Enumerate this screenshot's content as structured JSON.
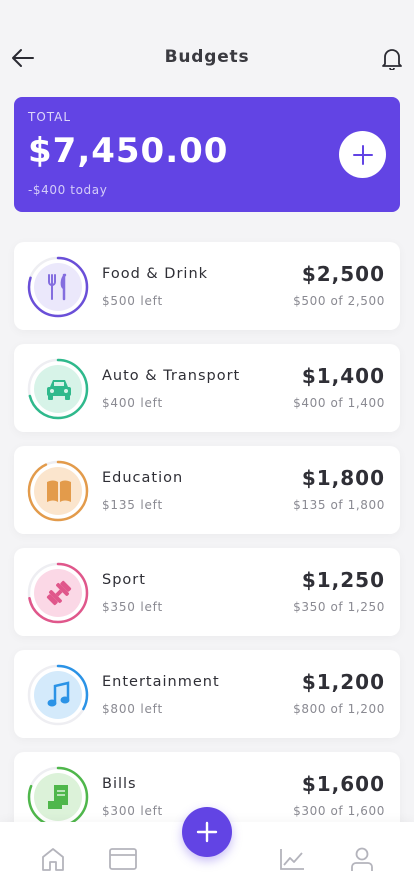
{
  "header": {
    "title": "Budgets",
    "back_icon": "arrow-left-icon",
    "notification_icon": "bell-icon"
  },
  "total": {
    "label": "TOTAL",
    "amount": "$7,450.00",
    "change": "-$400 today",
    "add_icon": "plus-icon",
    "color": "#6244e4"
  },
  "budgets": [
    {
      "name": "Food & Drink",
      "left": "$500 left",
      "amount": "$2,500",
      "of": "$500 of 2,500",
      "icon": "fork-knife-icon",
      "color": "#6a4fd8",
      "bg": "#ebe8fb",
      "progress": 0.8
    },
    {
      "name": "Auto & Transport",
      "left": "$400 left",
      "amount": "$1,400",
      "of": "$400 of 1,400",
      "icon": "car-icon",
      "color": "#2fb98c",
      "bg": "#d7f3e8",
      "progress": 0.71
    },
    {
      "name": "Education",
      "left": "$135 left",
      "amount": "$1,800",
      "of": "$135 of 1,800",
      "icon": "book-icon",
      "color": "#e39b4b",
      "bg": "#fbe5cd",
      "progress": 0.93
    },
    {
      "name": "Sport",
      "left": "$350 left",
      "amount": "$1,250",
      "of": "$350 of 1,250",
      "icon": "dumbbell-icon",
      "color": "#e0578b",
      "bg": "#fbd8e6",
      "progress": 0.72
    },
    {
      "name": "Entertainment",
      "left": "$800 left",
      "amount": "$1,200",
      "of": "$800 of 1,200",
      "icon": "music-note-icon",
      "color": "#2b93e6",
      "bg": "#d4eafb",
      "progress": 0.33
    },
    {
      "name": "Bills",
      "left": "$300 left",
      "amount": "$1,600",
      "of": "$300 of 1,600",
      "icon": "receipt-icon",
      "color": "#4fb74b",
      "bg": "#dcf2d9",
      "progress": 0.81
    }
  ],
  "tabbar": {
    "items": [
      "home-icon",
      "card-icon",
      "chart-icon",
      "profile-icon"
    ],
    "fab_icon": "plus-icon"
  }
}
